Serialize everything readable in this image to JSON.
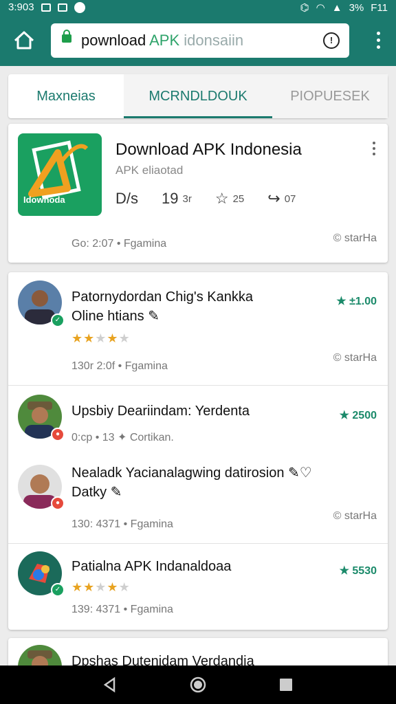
{
  "status": {
    "time": "3:903",
    "battery": "3%",
    "network": "F11"
  },
  "browser": {
    "url_part1": "pownload ",
    "url_part2": "APK",
    "url_part3": " idonsaiin"
  },
  "tabs": [
    {
      "label": "Maxneias"
    },
    {
      "label": "MCRNDLDOUK"
    },
    {
      "label": "PIOPUESEK"
    }
  ],
  "app": {
    "title": "Download APK Indonesia",
    "subtitle": "APK eliaotad",
    "icon_label": "Idownoda",
    "stat1": "D/s",
    "stat2_num": "19",
    "stat2_unit": "3r",
    "stat3": "25",
    "stat4": "07",
    "time_meta": "Go: 2:07 • Fgamina",
    "share_label": "© starHa"
  },
  "comments": [
    {
      "line1": "Patornydordan Chig's Kankka",
      "line2": "Oline htians ✎",
      "price": "★ ±1.00",
      "rating": 2.5,
      "meta": "130r 2:0f • Fgamina",
      "share": "© starHa"
    },
    {
      "line1": "Upsbiy Deariindam: Yerdenta",
      "line2": "",
      "price": "★ 2500",
      "extra_meta": "0:cp • 13  ✦ Cortikan.",
      "rating": null,
      "meta": "",
      "share": ""
    },
    {
      "line1": "Nealadk Yacianalagwing datirosion ✎♡",
      "line2": "Datky ✎",
      "price": "",
      "rating": null,
      "meta": "130: 4371 • Fgamina",
      "share": "© starHa"
    },
    {
      "line1": "Patialna APK Indanaldoaa",
      "line2": "",
      "price": "★ 5530",
      "rating": 2.5,
      "meta": "139: 4371 • Fgamina",
      "share": ""
    },
    {
      "line1": "Dpshas Dutenidam Verdandia",
      "line2": "",
      "price": "",
      "rating": null,
      "meta": "",
      "share": ""
    }
  ],
  "colors": {
    "brand": "#1b7a6e",
    "accent": "#1aa060",
    "star": "#e8a321"
  }
}
